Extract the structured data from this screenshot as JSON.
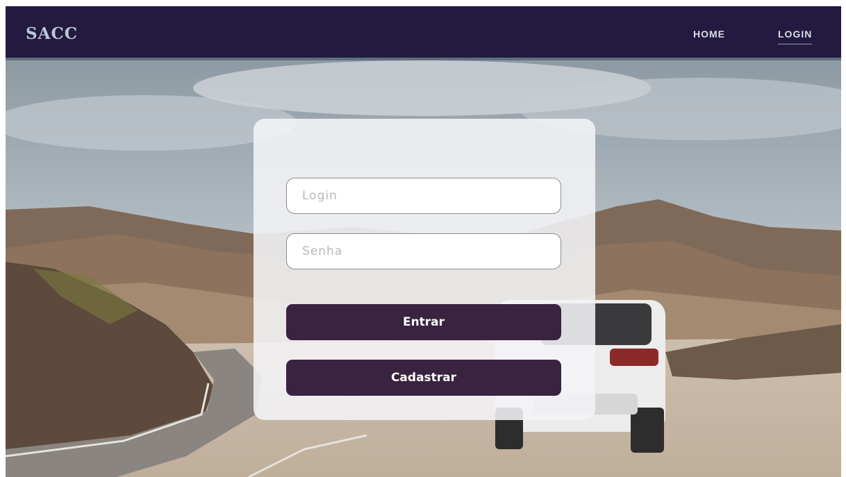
{
  "navbar": {
    "brand": "SACC",
    "links": [
      {
        "label": "HOME"
      },
      {
        "label": "LOGIN",
        "active": true
      }
    ]
  },
  "login_form": {
    "login_placeholder": "Login",
    "password_placeholder": "Senha",
    "enter_label": "Entrar",
    "register_label": "Cadastrar"
  },
  "colors": {
    "navbar_bg": "#241a3f",
    "button_bg": "#3a2340",
    "brand_text": "#b9c6d6"
  }
}
